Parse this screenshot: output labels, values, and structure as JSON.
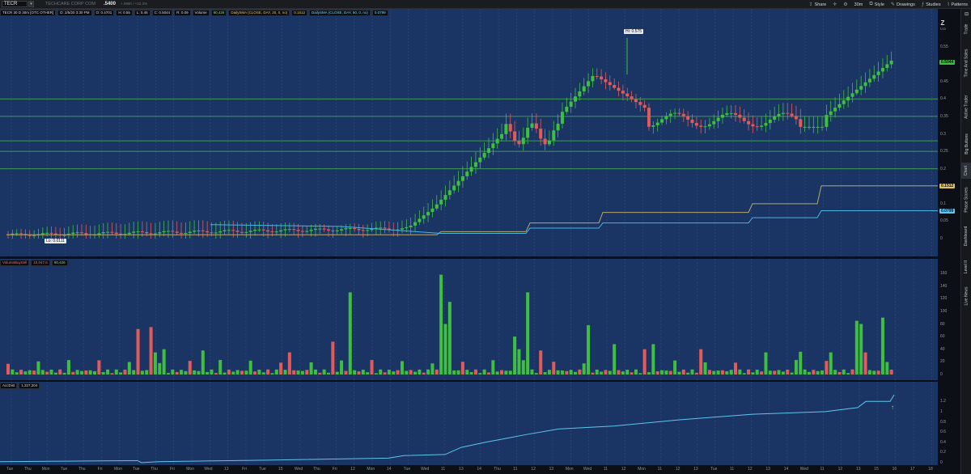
{
  "toolbar": {
    "symbol": "TECR",
    "company": "TECHCARE CORP COM",
    "last": ".5400",
    "change": "+.0980 / +22.3%",
    "share": "Share",
    "timeframe": "30m",
    "style": "Style",
    "drawings": "Drawings",
    "studies": "Studies",
    "patterns": "Patterns"
  },
  "price_panel": {
    "header": "TECR 30 D 30m [OTC OTHER]",
    "ohlc": "D: 2/5/20 3:30 PM",
    "open": "O: 0.4701",
    "high": "H: 0.55",
    "low": "L: 0.46",
    "close": "C: 0.5044",
    "range": "R: 0.09",
    "volume_label": "Volume",
    "volume_value": "90,426",
    "sma20_label": "DailySMA (CLOSE, DAY, 20, 0, no)",
    "sma20_value": "0.1512",
    "sma50_label": "DailySMA (CLOSE, DAY, 50, 0, no)",
    "sma50_value": "0.0799",
    "hi_label": "Hi: 0.575",
    "lo_label": "Lo: 0.0111",
    "last_tag": "0.5044",
    "sma20_tag": "0.1512",
    "sma50_tag": "0.0799",
    "ticks": [
      "0.6",
      "0.55",
      "0.5",
      "0.45",
      "0.4",
      "0.35",
      "0.3",
      "0.25",
      "0.2",
      "0.15",
      "0.1",
      "0.05",
      "0"
    ]
  },
  "volume_panel": {
    "header": "VolumeBuySell",
    "sell_value": "10,047.6",
    "buy_value": "90,426",
    "ticks": [
      "160",
      "140",
      "120",
      "100",
      "80",
      "60",
      "40",
      "20",
      "0"
    ],
    "unit": "<thousands>"
  },
  "ad_panel": {
    "header": "AccDist",
    "value": "1,327,204",
    "ticks": [
      "1.2",
      "1",
      "0.8",
      "0.6",
      "0.4",
      "0.2",
      "0"
    ],
    "unit": "<millions>"
  },
  "x_axis_labels": [
    "Tue",
    "Thu",
    "Mon",
    "Tue",
    "Thu",
    "Fri",
    "Mon",
    "Tue",
    "Thu",
    "Fri",
    "Mon",
    "Wed",
    "13",
    "Fri",
    "Tue",
    "15",
    "Wed",
    "Thu",
    "Fri",
    "12",
    "Mon",
    "14",
    "Tue",
    "Wed",
    "11",
    "13",
    "14",
    "Thu",
    "11",
    "12",
    "13",
    "Mon",
    "Wed",
    "11",
    "12",
    "Mon",
    "11",
    "12",
    "13",
    "Tue",
    "11",
    "12",
    "13",
    "14",
    "Wed",
    "11",
    "12",
    "13",
    "15",
    "16",
    "17",
    "18"
  ],
  "sidebar": {
    "tabs": [
      "Trade",
      "Time And Sales",
      "Active Trader",
      "Big Buttons",
      "Chart",
      "Phase Scores",
      "Dashboard",
      "Level II",
      "Live News"
    ],
    "active": "Chart"
  },
  "colors": {
    "panel_bg": "#1a3563",
    "up_candle": "#3fbf3f",
    "down_candle": "#e25b5b",
    "sma20": "#b9a76d",
    "sma50": "#47b4e6",
    "hline": "#3f9a5a"
  },
  "chart_data": {
    "type": "candlestick",
    "high": 0.575,
    "low": 0.0111,
    "last": 0.5044,
    "horizontal_levels": [
      0.4,
      0.35,
      0.28,
      0.25,
      0.2
    ],
    "sma20_last": 0.1512,
    "sma50_last": 0.0799,
    "accdist_last": 1327204
  }
}
